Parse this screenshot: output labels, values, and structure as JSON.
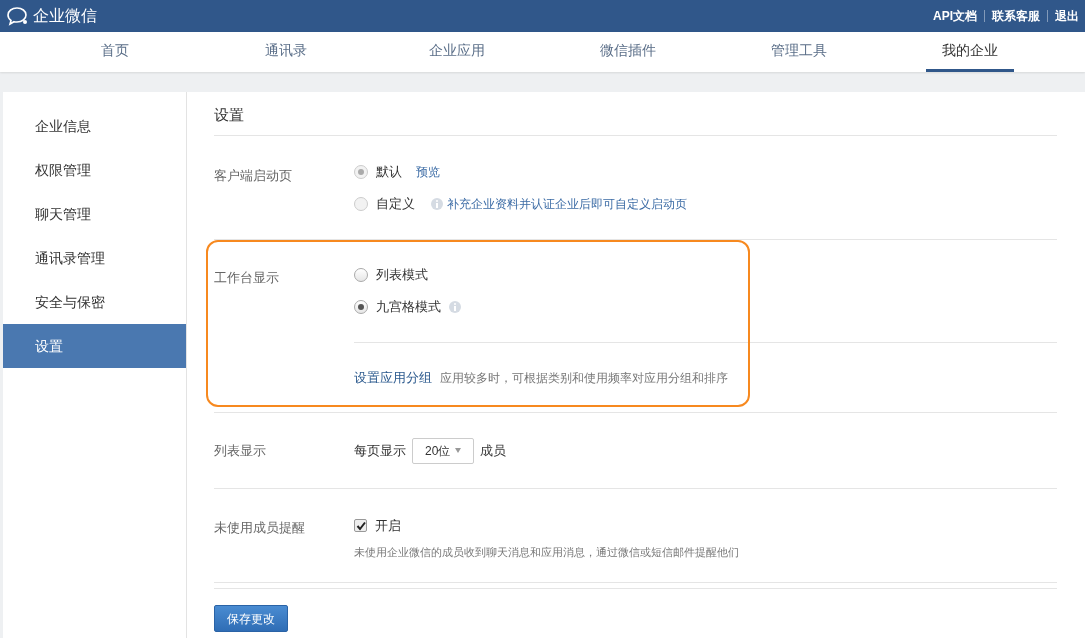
{
  "header": {
    "brand": "企业微信",
    "links": [
      "API文档",
      "联系客服",
      "退出"
    ]
  },
  "nav": [
    {
      "label": "首页",
      "selected": false
    },
    {
      "label": "通讯录",
      "selected": false
    },
    {
      "label": "企业应用",
      "selected": false
    },
    {
      "label": "微信插件",
      "selected": false
    },
    {
      "label": "管理工具",
      "selected": false
    },
    {
      "label": "我的企业",
      "selected": true
    }
  ],
  "sidebar": {
    "items": [
      {
        "label": "企业信息",
        "selected": false
      },
      {
        "label": "权限管理",
        "selected": false
      },
      {
        "label": "聊天管理",
        "selected": false
      },
      {
        "label": "通讯录管理",
        "selected": false
      },
      {
        "label": "安全与保密",
        "selected": false
      },
      {
        "label": "设置",
        "selected": true
      }
    ]
  },
  "page_title": "设置",
  "sections": [
    {
      "kind": "radios",
      "label": "客户端启动页",
      "highlighted": false,
      "options": [
        {
          "label": "默认",
          "selected": true,
          "disabled": true,
          "link": "预览"
        },
        {
          "label": "自定义",
          "selected": false,
          "disabled": true,
          "hint": "补充企业资料并认证企业后即可自定义启动页"
        }
      ]
    },
    {
      "kind": "radios",
      "label": "工作台显示",
      "highlighted": true,
      "options": [
        {
          "label": "列表模式",
          "selected": false,
          "disabled": false
        },
        {
          "label": "九宫格模式",
          "selected": true,
          "disabled": false,
          "info": true
        }
      ],
      "footer": {
        "link": "设置应用分组",
        "note": "应用较多时，可根据类别和使用频率对应用分组和排序"
      }
    },
    {
      "kind": "select",
      "label": "列表显示",
      "prefix": "每页显示",
      "value": "20位",
      "suffix": "成员"
    },
    {
      "kind": "checkbox",
      "label": "未使用成员提醒",
      "checked": true,
      "option": "开启",
      "note": "未使用企业微信的成员收到聊天消息和应用消息，通过微信或短信邮件提醒他们"
    }
  ],
  "save_button": "保存更改"
}
